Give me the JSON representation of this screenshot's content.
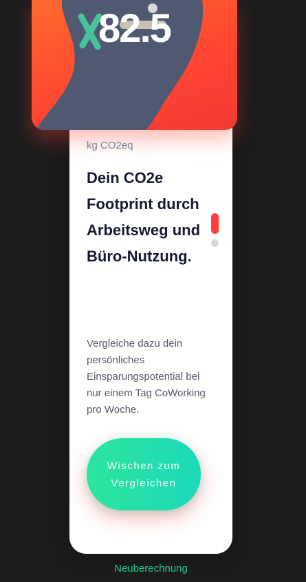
{
  "hero": {
    "value": "82.5",
    "unit": "kg CO2eq"
  },
  "content": {
    "headline": "Dein CO2e Footprint durch Arbeitsweg und Büro-Nutzung.",
    "description": "Vergleiche dazu dein persönliches Einsparungspotential bei nur einem Tag CoWorking pro Woche."
  },
  "actions": {
    "swipe_label": "Wischen zum Vergleichen",
    "recalc_label": "Neuberechnung"
  },
  "pager": {
    "pages": 2,
    "active_index": 0
  },
  "colors": {
    "hero_gradient_start": "#ff6a2e",
    "hero_gradient_end": "#f23b35",
    "illustration_blob": "#4f5a72",
    "button_gradient_start": "#2ee59d",
    "button_gradient_end": "#1bd9b9",
    "link": "#21c986",
    "pager_active": "#ff3b3b",
    "pager_inactive": "#d4d6de",
    "background": "#1c1c1c"
  },
  "icons": [
    "cross-mark-icon",
    "bicycle-illustration"
  ]
}
